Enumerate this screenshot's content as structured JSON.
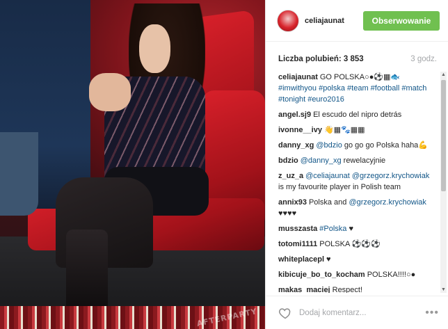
{
  "header": {
    "username": "celiajaunat",
    "follow_label": "Obserwowanie"
  },
  "stats": {
    "likes_label": "Liczba polubień: 3 853",
    "time_ago": "3 godz."
  },
  "comments": [
    {
      "user": "celiajaunat",
      "parts": [
        {
          "t": "GO POLSKA○●⚽▦🐟",
          "tag": false
        },
        {
          "t": " #imwithyou #polska #team #football #match #tonight #euro2016",
          "tag": true
        }
      ]
    },
    {
      "user": "angel.sj9",
      "parts": [
        {
          "t": "El escudo del nipro detrás",
          "tag": false
        }
      ]
    },
    {
      "user": "ivonne__ivy",
      "parts": [
        {
          "t": "👋▦🐾▦▦",
          "tag": false
        }
      ]
    },
    {
      "user": "danny_xg",
      "parts": [
        {
          "t": "@bdzio",
          "tag": true
        },
        {
          "t": " go go go Polska haha💪",
          "tag": false
        }
      ]
    },
    {
      "user": "bdzio",
      "parts": [
        {
          "t": "@danny_xg",
          "tag": true
        },
        {
          "t": " rewelacyjnie",
          "tag": false
        }
      ]
    },
    {
      "user": "z_uz_a",
      "parts": [
        {
          "t": "@celiajaunat @grzegorz.krychowiak",
          "tag": true
        },
        {
          "t": " is my favourite player in Polish team",
          "tag": false
        }
      ]
    },
    {
      "user": "annix93",
      "parts": [
        {
          "t": "Polska and ",
          "tag": false
        },
        {
          "t": "@grzegorz.krychowiak",
          "tag": true
        },
        {
          "t": " ♥♥♥♥",
          "tag": false
        }
      ]
    },
    {
      "user": "musszasta",
      "parts": [
        {
          "t": "#Polska",
          "tag": true
        },
        {
          "t": " ♥",
          "tag": false
        }
      ]
    },
    {
      "user": "totomi1111",
      "parts": [
        {
          "t": "POLSKA ⚽⚽⚽",
          "tag": false
        }
      ]
    },
    {
      "user": "whiteplacepl",
      "parts": [
        {
          "t": "♥",
          "tag": false
        }
      ]
    },
    {
      "user": "kibicuje_bo_to_kocham",
      "parts": [
        {
          "t": "POLSKA!!!!○●",
          "tag": false
        }
      ]
    },
    {
      "user": "makas_maciej",
      "parts": [
        {
          "t": "Respect!",
          "tag": false
        }
      ]
    }
  ],
  "footer": {
    "comment_placeholder": "Dodaj komentarz...",
    "more_label": "•••"
  },
  "photo": {
    "watermark": "AFTERPARTY"
  },
  "colors": {
    "follow_button": "#70c050",
    "link": "#125688",
    "muted": "#a5a7aa"
  },
  "icons": {
    "heart": "heart-outline-icon",
    "more": "more-horizontal-icon"
  }
}
